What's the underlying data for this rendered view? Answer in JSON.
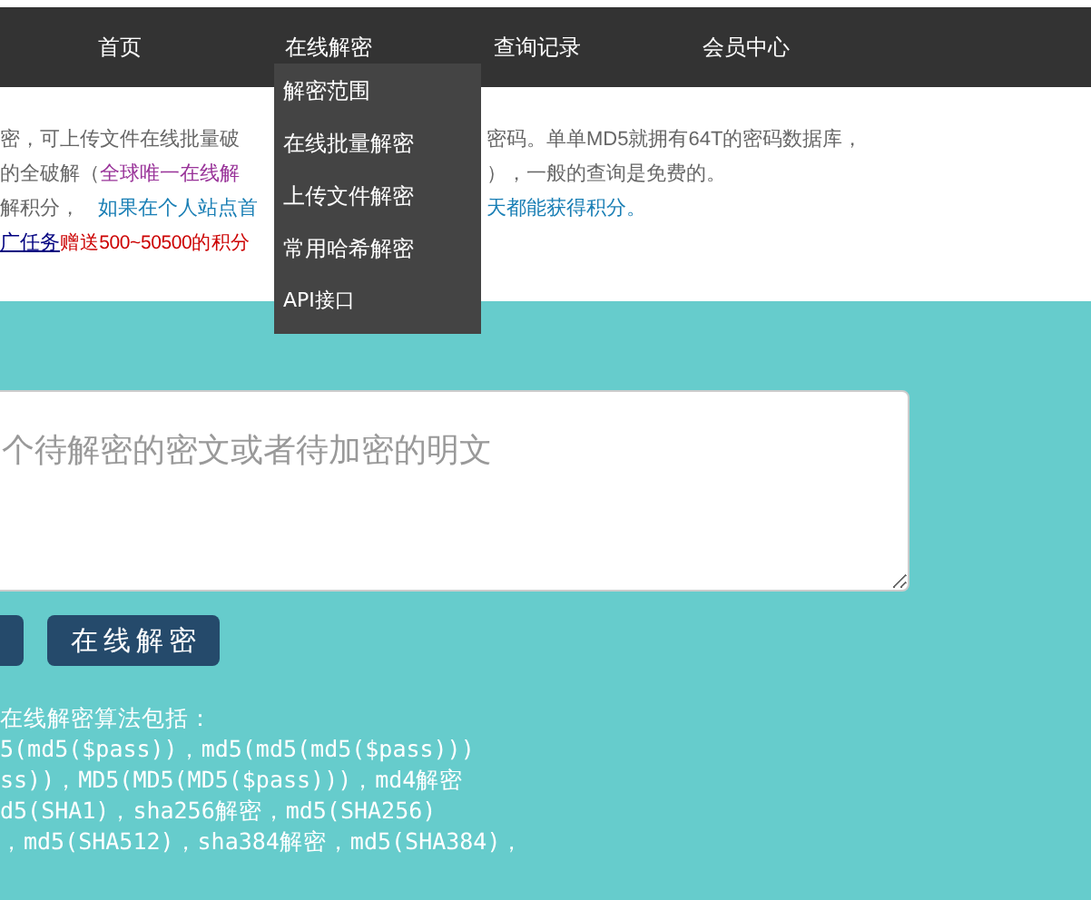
{
  "nav": {
    "items": [
      {
        "label": "首页"
      },
      {
        "label": "在线解密",
        "menu": [
          "解密范围",
          "在线批量解密",
          "上传文件解密",
          "常用哈希解密",
          "API接口"
        ]
      },
      {
        "label": "查询记录"
      },
      {
        "label": "会员中心"
      }
    ]
  },
  "intro": [
    {
      "left": [
        {
          "kind": "plain",
          "text": "密，可上传文件在线批量破"
        }
      ],
      "right": [
        {
          "kind": "plain",
          "text": "密码。单单MD5就拥有64T的密码数据库，"
        }
      ]
    },
    {
      "left": [
        {
          "kind": "plain",
          "text": "的全破解（"
        },
        {
          "kind": "highlight",
          "text": "全球唯一在线解"
        }
      ],
      "right": [
        {
          "kind": "plain",
          "text": "），一般的查询是免费的。"
        }
      ]
    },
    {
      "left": [
        {
          "kind": "plain",
          "text": "解积分，"
        },
        {
          "kind": "tip",
          "text": "如果在个人站点首"
        }
      ],
      "right": [
        {
          "kind": "tip",
          "text": "天都能获得积分。"
        }
      ]
    },
    {
      "left": [
        {
          "kind": "link",
          "text": "广任务"
        },
        {
          "kind": "reward",
          "text": "赠送500~50500的积分"
        }
      ]
    }
  ],
  "input": {
    "placeholder": "个待解密的密文或者待加密的明文"
  },
  "buttons": [
    {
      "kind": "clipped"
    },
    {
      "kind": "full",
      "label": "在线解密"
    }
  ],
  "algorithms": [
    "在线解密算法包括：",
    "5(md5($pass))，md5(md5(md5($pass)))",
    "ss))，MD5(MD5(MD5($pass)))，md4解密",
    "d5(SHA1)，sha256解密，md5(SHA256)",
    "，md5(SHA512)，sha384解密，md5(SHA384)，"
  ]
}
